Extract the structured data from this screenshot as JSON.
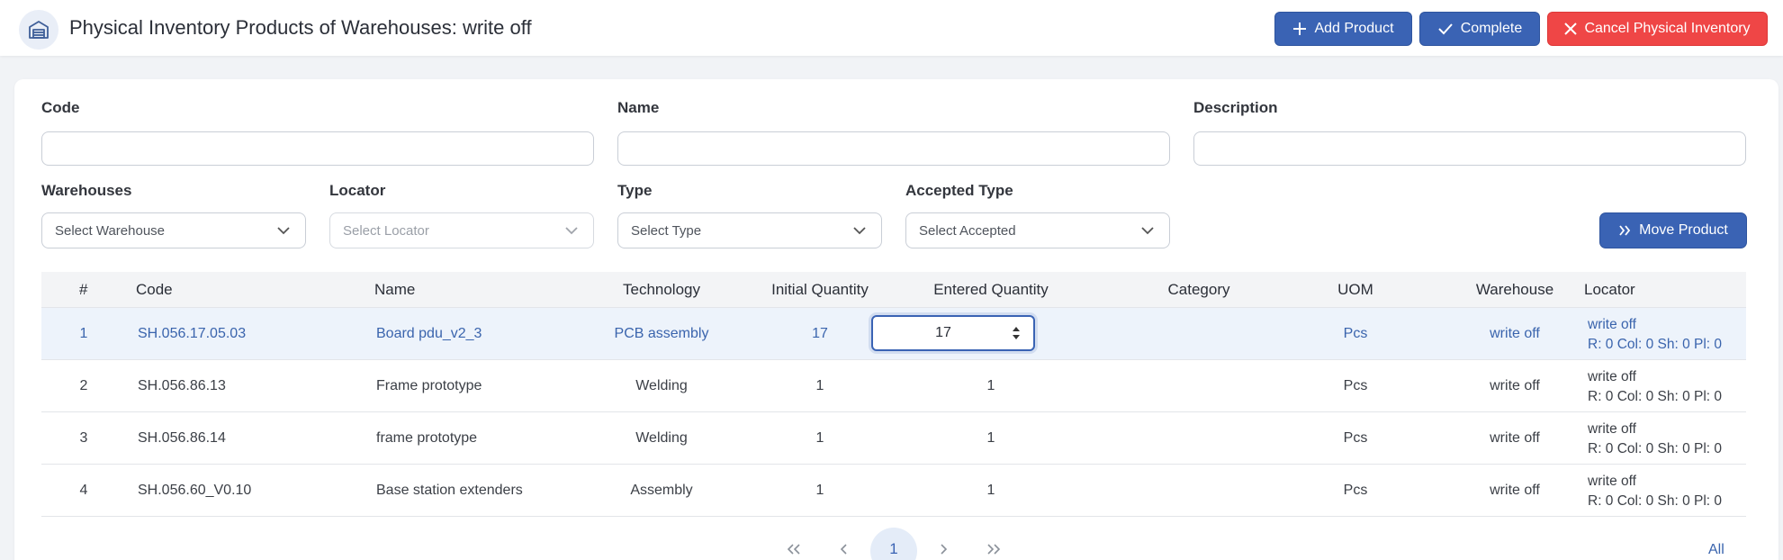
{
  "header": {
    "title": "Physical Inventory Products of Warehouses: write off",
    "logo_icon": "warehouse-icon",
    "buttons": {
      "add_product": "Add Product",
      "complete": "Complete",
      "cancel": "Cancel Physical Inventory"
    }
  },
  "filters": {
    "code_label": "Code",
    "name_label": "Name",
    "description_label": "Description",
    "warehouses_label": "Warehouses",
    "warehouses_placeholder": "Select Warehouse",
    "locator_label": "Locator",
    "locator_placeholder": "Select Locator",
    "type_label": "Type",
    "type_placeholder": "Select Type",
    "accepted_label": "Accepted Type",
    "accepted_placeholder": "Select Accepted",
    "move_button": "Move Product"
  },
  "table": {
    "columns": [
      "#",
      "Code",
      "Name",
      "Technology",
      "Initial Quantity",
      "Entered Quantity",
      "Category",
      "UOM",
      "Warehouse",
      "Locator"
    ],
    "rows": [
      {
        "num": "1",
        "code": "SH.056.17.05.03",
        "name": "Board pdu_v2_3",
        "technology": "PCB assembly",
        "initial": "17",
        "entered": "17",
        "category": "",
        "uom": "Pcs",
        "warehouse": "write off",
        "locator_name": "write off",
        "locator_detail": "R: 0 Col: 0 Sh: 0 Pl: 0"
      },
      {
        "num": "2",
        "code": "SH.056.86.13",
        "name": "Frame prototype",
        "technology": "Welding",
        "initial": "1",
        "entered": "1",
        "category": "",
        "uom": "Pcs",
        "warehouse": "write off",
        "locator_name": "write off",
        "locator_detail": "R: 0 Col: 0 Sh: 0 Pl: 0"
      },
      {
        "num": "3",
        "code": "SH.056.86.14",
        "name": "frame prototype",
        "technology": "Welding",
        "initial": "1",
        "entered": "1",
        "category": "",
        "uom": "Pcs",
        "warehouse": "write off",
        "locator_name": "write off",
        "locator_detail": "R: 0 Col: 0 Sh: 0 Pl: 0"
      },
      {
        "num": "4",
        "code": "SH.056.60_V0.10",
        "name": "Base station extenders",
        "technology": "Assembly",
        "initial": "1",
        "entered": "1",
        "category": "",
        "uom": "Pcs",
        "warehouse": "write off",
        "locator_name": "write off",
        "locator_detail": "R: 0 Col: 0 Sh: 0 Pl: 0"
      }
    ]
  },
  "pagination": {
    "first": "«",
    "prev": "‹",
    "current": "1",
    "next": "›",
    "last": "»",
    "page_size": "All"
  },
  "colors": {
    "primary": "#3a63b4",
    "danger": "#ef4646",
    "selected_row": "#edf3fb"
  }
}
